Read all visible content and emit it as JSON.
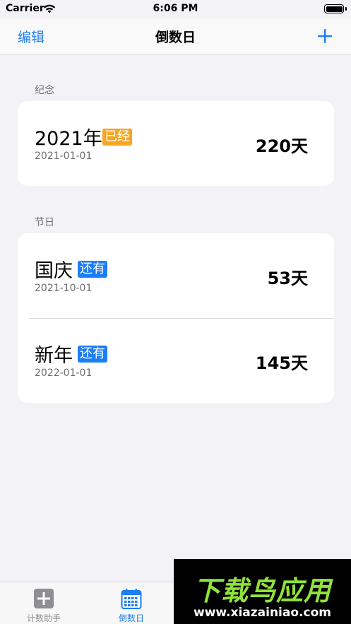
{
  "status_bar": {
    "carrier": "Carrier",
    "time": "6:06 PM",
    "icons": [
      "wifi-icon",
      "battery-icon"
    ]
  },
  "nav": {
    "edit_label": "编辑",
    "title": "倒数日",
    "add_icon": "plus-icon"
  },
  "sections": [
    {
      "header": "纪念",
      "items": [
        {
          "name": "2021年",
          "badge": "已经",
          "badge_type": "past",
          "date": "2021-01-01",
          "days": "220天"
        }
      ]
    },
    {
      "header": "节日",
      "items": [
        {
          "name": "国庆",
          "badge": "还有",
          "badge_type": "future",
          "date": "2021-10-01",
          "days": "53天"
        },
        {
          "name": "新年",
          "badge": "还有",
          "badge_type": "future",
          "date": "2022-01-01",
          "days": "145天"
        }
      ]
    }
  ],
  "tabs": [
    {
      "label": "计数助手",
      "icon": "plus-square-icon",
      "active": false
    },
    {
      "label": "倒数日",
      "icon": "calendar-icon",
      "active": true
    }
  ],
  "colors": {
    "accent": "#1b7ef5",
    "badge_past": "#f5a623",
    "badge_future": "#1b7ef5",
    "background": "#f2f2f7"
  },
  "watermark": {
    "title": "下载鸟应用",
    "url": "www.xiazainiao.com"
  }
}
